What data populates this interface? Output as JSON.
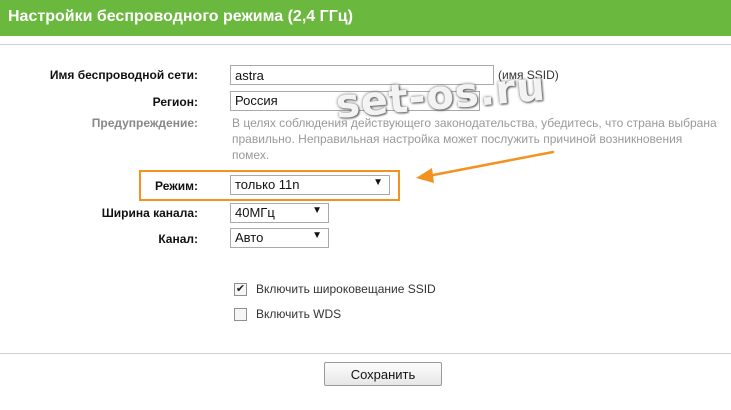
{
  "header": {
    "title": "Настройки беспроводного режима (2,4 ГГц)"
  },
  "form": {
    "ssid": {
      "label": "Имя беспроводной сети:",
      "value": "astra",
      "hint": "(имя SSID)"
    },
    "region": {
      "label": "Регион:",
      "value": "Россия"
    },
    "warning": {
      "label": "Предупреждение:",
      "text": "В целях соблюдения действующего законодательства, убедитесь, что страна выбрана правильно. Неправильная настройка может послужить причиной возникновения помех."
    },
    "mode": {
      "label": "Режим:",
      "value": "только 11n"
    },
    "channel_width": {
      "label": "Ширина канала:",
      "value": "40МГц"
    },
    "channel": {
      "label": "Канал:",
      "value": "Авто"
    },
    "ssid_broadcast": {
      "label": "Включить широковещание SSID",
      "checked": true,
      "mark": "✔"
    },
    "wds": {
      "label": "Включить WDS",
      "checked": false
    }
  },
  "save_label": "Сохранить",
  "watermark": "set-os.ru",
  "colors": {
    "header": "#6bb83f",
    "highlight": "#f39220",
    "arrow": "#f39220"
  }
}
